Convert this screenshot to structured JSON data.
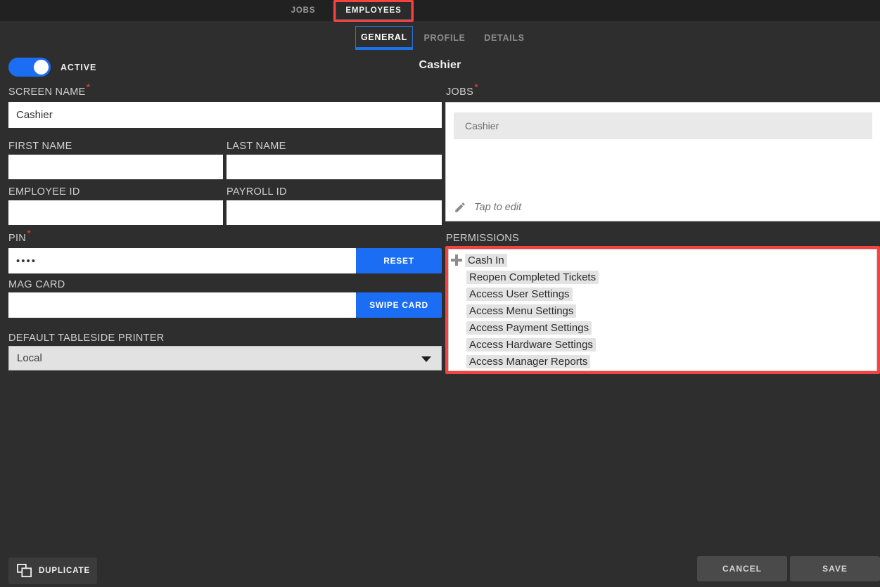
{
  "topnav": {
    "items": [
      {
        "label": "JOBS",
        "active": false
      },
      {
        "label": "EMPLOYEES",
        "active": true
      }
    ],
    "highlight_color": "#f6433f"
  },
  "subtabs": {
    "items": [
      {
        "label": "GENERAL",
        "active": true
      },
      {
        "label": "PROFILE",
        "active": false
      },
      {
        "label": "DETAILS",
        "active": false
      }
    ],
    "accent_color": "#1a73e8"
  },
  "header": {
    "title": "Cashier"
  },
  "toggle": {
    "label": "ACTIVE",
    "state": "on",
    "color": "#1b6ef3"
  },
  "left_column": {
    "screen_name": {
      "label": "SCREEN NAME",
      "required": true,
      "value": "Cashier",
      "placeholder": ""
    },
    "first_name": {
      "label": "FIRST NAME",
      "required": false,
      "value": "",
      "placeholder": ""
    },
    "last_name": {
      "label": "LAST NAME",
      "required": false,
      "value": "",
      "placeholder": ""
    },
    "employee_id": {
      "label": "EMPLOYEE ID",
      "required": false,
      "value": "",
      "placeholder": ""
    },
    "payroll_id": {
      "label": "PAYROLL ID",
      "required": false,
      "value": "",
      "placeholder": ""
    },
    "pin": {
      "label": "PIN",
      "required": true,
      "value": "••••",
      "placeholder": "",
      "button_label": "RESET"
    },
    "mag_card": {
      "label": "MAG CARD",
      "required": false,
      "value": "",
      "placeholder": "",
      "button_label": "SWIPE CARD"
    },
    "default_tableside_printer": {
      "label": "DEFAULT TABLESIDE PRINTER",
      "selected": "Local",
      "options": [
        "Local"
      ],
      "icon": "chevron-down-icon"
    }
  },
  "right_column": {
    "jobs": {
      "label": "JOBS",
      "required": true,
      "items": [
        "Cashier"
      ],
      "edit_hint": "Tap to edit",
      "edit_icon": "pencil-icon"
    },
    "permissions": {
      "label": "PERMISSIONS",
      "highlighted": true,
      "expand_icon": "plus-icon",
      "items": [
        "Cash In",
        "Reopen Completed Tickets",
        "Access User Settings",
        "Access Menu Settings",
        "Access Payment Settings",
        "Access Hardware Settings",
        "Access Manager Reports"
      ]
    }
  },
  "footer": {
    "duplicate_label": "DUPLICATE",
    "duplicate_icon": "copy-icon",
    "cancel_label": "CANCEL",
    "save_label": "SAVE"
  }
}
